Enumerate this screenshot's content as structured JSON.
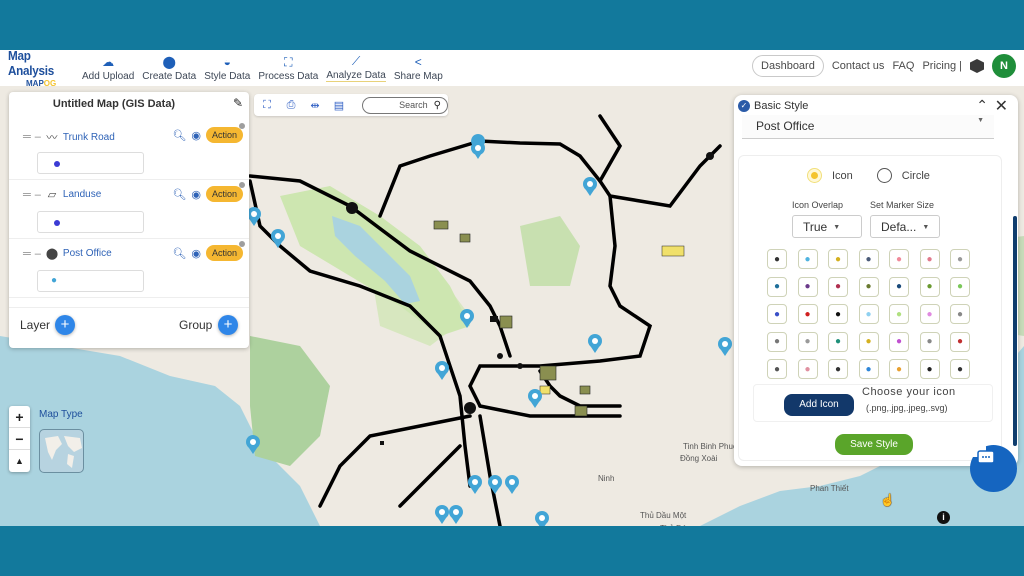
{
  "header": {
    "brand_title": "Map Analysis",
    "brand_sub_prefix": "MAP",
    "brand_sub_suffix": "OG",
    "nav": [
      {
        "label": "Add Upload",
        "icon": "cloud-upload-icon"
      },
      {
        "label": "Create Data",
        "icon": "map-pin-icon"
      },
      {
        "label": "Style Data",
        "icon": "paint-bucket-icon"
      },
      {
        "label": "Process Data",
        "icon": "process-icon"
      },
      {
        "label": "Analyze Data",
        "icon": "analyze-icon"
      },
      {
        "label": "Share Map",
        "icon": "share-icon"
      }
    ],
    "dashboard_label": "Dashboard",
    "contact_label": "Contact us",
    "faq_label": "FAQ",
    "pricing_label": "Pricing |",
    "avatar_initial": "N"
  },
  "layer_panel": {
    "title": "Untitled Map (GIS Data)",
    "layers": [
      {
        "name": "Trunk Road",
        "type_icon": "line-icon",
        "action_label": "Action",
        "legend": "dot"
      },
      {
        "name": "Landuse",
        "type_icon": "polygon-icon",
        "action_label": "Action",
        "legend": "dot"
      },
      {
        "name": "Post Office",
        "type_icon": "pin-icon",
        "action_label": "Action",
        "legend": "pin"
      }
    ],
    "layer_label": "Layer",
    "group_label": "Group"
  },
  "toolbar": {
    "search_placeholder": "Search"
  },
  "style_panel": {
    "title": "Basic Style",
    "selected_layer": "Post Office",
    "radio_icon_label": "Icon",
    "radio_circle_label": "Circle",
    "radio_selected": "Icon",
    "icon_overlap_label": "Icon Overlap",
    "icon_overlap_value": "True",
    "marker_size_label": "Set Marker Size",
    "marker_size_value": "Defa...",
    "icon_colors": [
      [
        "#333333",
        "#4fb3e0",
        "#d4b020",
        "#4a5a78",
        "#f08a9a",
        "#e07a8c",
        "#999999"
      ],
      [
        "#1f6f9a",
        "#6a3a8a",
        "#b03050",
        "#6a7a30",
        "#1a4a7a",
        "#6a9a30",
        "#7bc85a"
      ],
      [
        "#3a50c8",
        "#d02020",
        "#111111",
        "#8fd0f0",
        "#b0e080",
        "#e08ae0",
        "#888888"
      ],
      [
        "#777777",
        "#999999",
        "#20907a",
        "#d4b020",
        "#c050d0",
        "#888888",
        "#c03030"
      ],
      [
        "#555555",
        "#e090a0",
        "#333333",
        "#2f86d8",
        "#e8a030",
        "#222222",
        "#333333"
      ]
    ],
    "add_icon_label": "Add Icon",
    "choose_title": "Choose your icon",
    "choose_sub": "(.png,.jpg,.jpeg,.svg)",
    "save_label": "Save Style"
  },
  "map": {
    "map_type_label": "Map Type",
    "zoom_in": "+",
    "zoom_out": "−",
    "north": "▲",
    "info": "i",
    "place_labels": [
      "Thủ Dầu Một",
      "Thủ Đức",
      "Phan Thiết",
      "Tinh Binh Phuoc",
      "Đồng Xoài",
      "Ninh"
    ]
  }
}
